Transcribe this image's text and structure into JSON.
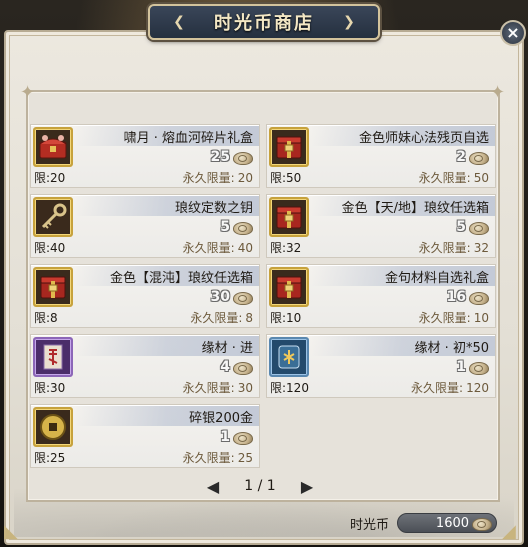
{
  "shop": {
    "title": "时光币商店",
    "close_label": "×"
  },
  "items": [
    {
      "name": "啸月 · 熔血河碎片礼盒",
      "price": "25",
      "limit": "限:20",
      "perm_label": "永久限量:",
      "perm_value": "20",
      "icon": "red-chest-icon",
      "frame": "gold"
    },
    {
      "name": "金色师妹心法残页自选",
      "price": "2",
      "limit": "限:50",
      "perm_label": "永久限量:",
      "perm_value": "50",
      "icon": "red-box-icon",
      "frame": "gold"
    },
    {
      "name": "琅纹定数之钥",
      "price": "5",
      "limit": "限:40",
      "perm_label": "永久限量:",
      "perm_value": "40",
      "icon": "key-icon",
      "frame": "gold"
    },
    {
      "name": "金色【天/地】琅纹任选箱",
      "price": "5",
      "limit": "限:32",
      "perm_label": "永久限量:",
      "perm_value": "32",
      "icon": "red-box-icon",
      "frame": "gold"
    },
    {
      "name": "金色【混沌】琅纹任选箱",
      "price": "30",
      "limit": "限:8",
      "perm_label": "永久限量:",
      "perm_value": "8",
      "icon": "red-box-icon",
      "frame": "gold"
    },
    {
      "name": "金句材料自选礼盒",
      "price": "16",
      "limit": "限:10",
      "perm_label": "永久限量:",
      "perm_value": "10",
      "icon": "red-box-icon",
      "frame": "gold"
    },
    {
      "name": "缘材 · 进",
      "price": "4",
      "limit": "限:30",
      "perm_label": "永久限量:",
      "perm_value": "30",
      "icon": "talisman-icon",
      "frame": "purple"
    },
    {
      "name": "缘材 · 初*50",
      "price": "1",
      "limit": "限:120",
      "perm_label": "永久限量:",
      "perm_value": "120",
      "icon": "rune-icon",
      "frame": "blue"
    },
    {
      "name": "碎银200金",
      "price": "1",
      "limit": "限:25",
      "perm_label": "永久限量:",
      "perm_value": "25",
      "icon": "coin-silver-icon",
      "frame": "gold"
    }
  ],
  "pager": {
    "prev": "◀",
    "page": "1 / 1",
    "next": "▶"
  },
  "currency": {
    "label": "时光币",
    "value": "1600"
  }
}
